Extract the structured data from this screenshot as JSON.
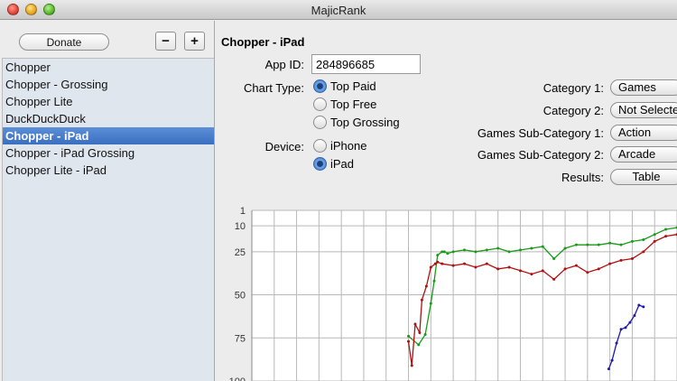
{
  "window": {
    "title": "MajicRank"
  },
  "sidebar": {
    "donate_label": "Donate",
    "minus_label": "−",
    "plus_label": "+",
    "items": [
      {
        "label": "Chopper",
        "selected": false
      },
      {
        "label": "Chopper - Grossing",
        "selected": false
      },
      {
        "label": "Chopper Lite",
        "selected": false
      },
      {
        "label": "DuckDuckDuck",
        "selected": false
      },
      {
        "label": "Chopper - iPad",
        "selected": true
      },
      {
        "label": "Chopper - iPad Grossing",
        "selected": false
      },
      {
        "label": "Chopper Lite - iPad",
        "selected": false
      }
    ]
  },
  "detail": {
    "heading": "Chopper - iPad",
    "app_id_label": "App ID:",
    "app_id_value": "284896685",
    "chart_type_label": "Chart Type:",
    "chart_type_options": [
      "Top Paid",
      "Top Free",
      "Top Grossing"
    ],
    "chart_type_selected": "Top Paid",
    "device_label": "Device:",
    "device_options": [
      "iPhone",
      "iPad"
    ],
    "device_selected": "iPad",
    "category1_label": "Category 1:",
    "category1_value": "Games",
    "category2_label": "Category 2:",
    "category2_value": "Not Selected",
    "sub1_label": "Games Sub-Category 1:",
    "sub1_value": "Action",
    "sub2_label": "Games Sub-Category 2:",
    "sub2_value": "Arcade",
    "results_label": "Results:",
    "results_value": "Table"
  },
  "chart_data": {
    "type": "line",
    "y_ticks": [
      1,
      10,
      25,
      50,
      75,
      100
    ],
    "ylim": [
      100,
      1
    ],
    "y_inverted": true,
    "grid": true,
    "x_columns": 19,
    "xlim": [
      0,
      19
    ],
    "series": [
      {
        "color": "#1a9a1a",
        "x": [
          7.0,
          7.45,
          7.75,
          8.0,
          8.15,
          8.3,
          8.5,
          8.6,
          8.75,
          9.0,
          9.5,
          10.0,
          10.5,
          11.0,
          11.5,
          12.0,
          12.5,
          13.0,
          13.5,
          14.0,
          14.5,
          15.0,
          15.5,
          16.0,
          16.5,
          17.0,
          17.5,
          18.0,
          18.5,
          19.0
        ],
        "y": [
          74,
          79,
          73,
          55,
          42,
          27,
          25,
          25,
          26,
          25,
          24,
          25,
          24,
          23,
          25,
          24,
          23,
          22,
          29,
          23,
          21,
          21,
          21,
          20,
          21,
          19,
          18,
          15,
          12,
          11
        ]
      },
      {
        "color": "#b01010",
        "x": [
          7.0,
          7.15,
          7.3,
          7.5,
          7.6,
          7.8,
          8.0,
          8.2,
          8.3,
          8.5,
          9.0,
          9.5,
          10.0,
          10.5,
          11.0,
          11.5,
          12.0,
          12.5,
          13.0,
          13.5,
          14.0,
          14.5,
          15.0,
          15.5,
          16.0,
          16.5,
          17.0,
          17.5,
          18.0,
          18.5,
          19.0
        ],
        "y": [
          77,
          91,
          67,
          72,
          53,
          45,
          34,
          32,
          31,
          32,
          33,
          32,
          34,
          32,
          35,
          34,
          36,
          38,
          36,
          41,
          35,
          33,
          37,
          35,
          32,
          30,
          29,
          25,
          19,
          16,
          15
        ]
      },
      {
        "color": "#1a1aa8",
        "x": [
          15.95,
          16.1,
          16.3,
          16.5,
          16.7,
          16.9,
          17.1,
          17.3,
          17.5
        ],
        "y": [
          93,
          88,
          78,
          70,
          69,
          66,
          62,
          56,
          57
        ]
      }
    ]
  }
}
